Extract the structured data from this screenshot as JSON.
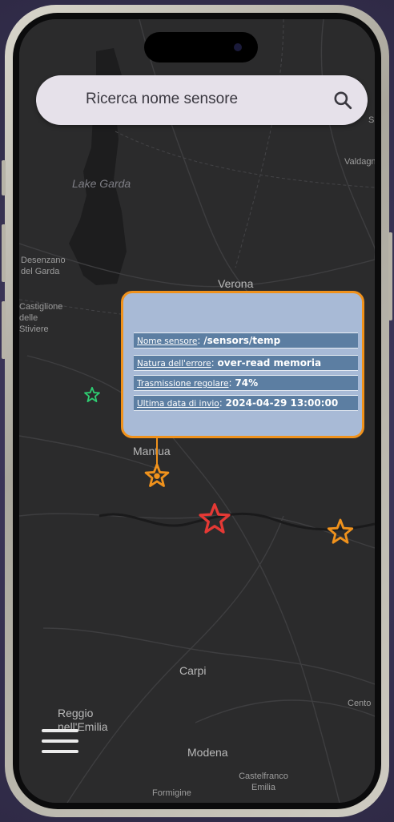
{
  "search": {
    "placeholder": "Ricerca nome sensore",
    "icon": "search-icon"
  },
  "map": {
    "labels": {
      "lake_garda": "Lake Garda",
      "desenzano": "Desenzano del Garda",
      "castiglione": "Castiglione delle Stiviere",
      "verona": "Verona",
      "valdagno": "Valdagn",
      "mantua": "Mantua",
      "carpi": "Carpi",
      "reggio": "Reggio nell'Emilia",
      "modena": "Modena",
      "castelfranco": "Castelfranco Emilia",
      "formigine": "Formigine",
      "cento": "Cento",
      "s_edge": "S"
    }
  },
  "popup": {
    "rows": [
      {
        "key": "Nome sensore",
        "sep": ": ",
        "value": "/sensors/temp"
      },
      {
        "key": "Natura dell'errore",
        "sep": ": ",
        "value": "over-read memoria"
      },
      {
        "key": "Trasmissione regolare",
        "sep": ": ",
        "value": "74%"
      },
      {
        "key": "Ultima data di invio",
        "sep": ": ",
        "value": "2024-04-29 13:00:00"
      }
    ]
  },
  "markers": [
    {
      "name": "sensor-marker-green",
      "color": "#2ecc71",
      "status": "ok"
    },
    {
      "name": "sensor-marker-selected",
      "color": "#f0921c",
      "status": "warning"
    },
    {
      "name": "sensor-marker-red",
      "color": "#e53935",
      "status": "error"
    },
    {
      "name": "sensor-marker-orange",
      "color": "#f0921c",
      "status": "warning"
    }
  ],
  "menu": {
    "icon": "hamburger-menu-icon"
  },
  "colors": {
    "accent": "#f0921c",
    "popup_bg": "#a8bad6",
    "popup_row": "#5c7ea2",
    "map_bg": "#2a2a2b"
  }
}
